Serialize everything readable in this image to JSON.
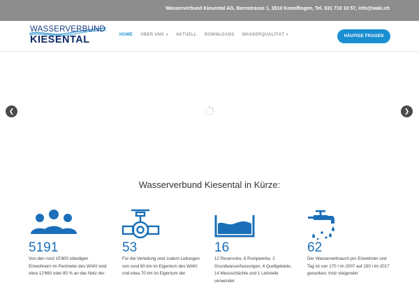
{
  "topbar": {
    "contact": "Wasserverbund Kiesental AG, Bernstrasse 1, 3510 Konolfingen, Tel. 031 710 10 57, info@waki.ch"
  },
  "logo": {
    "line1": "WASSERVERBUND",
    "line2": "KIESENTAL"
  },
  "nav": {
    "items": [
      {
        "label": "HOME",
        "active": true,
        "dropdown": false
      },
      {
        "label": "ÜBER UNS",
        "active": false,
        "dropdown": true
      },
      {
        "label": "AKTUELL",
        "active": false,
        "dropdown": false
      },
      {
        "label": "DOWNLOADS",
        "active": false,
        "dropdown": false
      },
      {
        "label": "WASSERQUALITÄT",
        "active": false,
        "dropdown": true
      }
    ],
    "cta_label": "HÄUFIGE FRAGEN"
  },
  "slider": {
    "prev_icon": "chevron-left-icon",
    "next_icon": "chevron-right-icon",
    "loading_icon": "spinner-icon"
  },
  "section": {
    "title": "Wasserverbund Kiesental in Kürze:"
  },
  "facts": [
    {
      "icon": "people-icon",
      "number": "5191",
      "text": "Von den rund 15'800 ständigen Einwohnern im Perimeter des WAKI sind etwa 12'660 oder 80 % an das Netz der"
    },
    {
      "icon": "pipe-valve-icon",
      "number": "53",
      "text": "Für die Verteilung sind zudem Leitungen von rund 60 km im Eigentum des WAKI und etwa 70 km im Eigentum der"
    },
    {
      "icon": "water-basin-icon",
      "number": "16",
      "text": "12 Reservoire, 6 Pumpwerke, 2 Grundwasserfassungen, 4 Quellgebiete, 14 Messschächte und 1 Leitstelle verwendet"
    },
    {
      "icon": "faucet-icon",
      "number": "62",
      "text": "Der Wasserverbrauch pro Einwohner und Tag ist von 170 l im 2007 auf 150 l im 2017 gesunken; trotz steigender"
    }
  ],
  "colors": {
    "accent": "#1a8fd0",
    "icon_blue": "#1a6fb8",
    "topbar_bg": "#8d8d8d"
  }
}
